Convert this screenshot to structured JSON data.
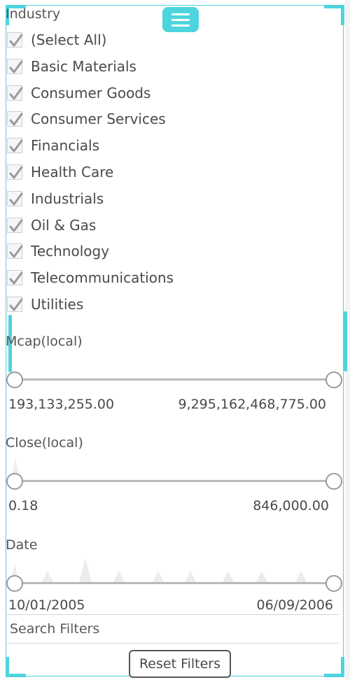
{
  "industry": {
    "label": "Industry",
    "items": [
      {
        "label": "(Select All)",
        "checked": true
      },
      {
        "label": "Basic Materials",
        "checked": true
      },
      {
        "label": "Consumer Goods",
        "checked": true
      },
      {
        "label": "Consumer Services",
        "checked": true
      },
      {
        "label": "Financials",
        "checked": true
      },
      {
        "label": "Health Care",
        "checked": true
      },
      {
        "label": "Industrials",
        "checked": true
      },
      {
        "label": "Oil & Gas",
        "checked": true
      },
      {
        "label": "Technology",
        "checked": true
      },
      {
        "label": "Telecommunications",
        "checked": true
      },
      {
        "label": "Utilities",
        "checked": true
      }
    ]
  },
  "mcap": {
    "label": "Mcap(local)",
    "min": "193,133,255.00",
    "max": "9,295,162,468,775.00"
  },
  "close": {
    "label": "Close(local)",
    "min": "0.18",
    "max": "846,000.00"
  },
  "date": {
    "label": "Date",
    "min": "10/01/2005",
    "max": "06/09/2006"
  },
  "search": {
    "placeholder": "Search Filters",
    "value": ""
  },
  "reset_label": "Reset Filters",
  "colors": {
    "accent": "#4dd4df",
    "track": "#b9b9b9",
    "text": "#4a4a4a"
  }
}
